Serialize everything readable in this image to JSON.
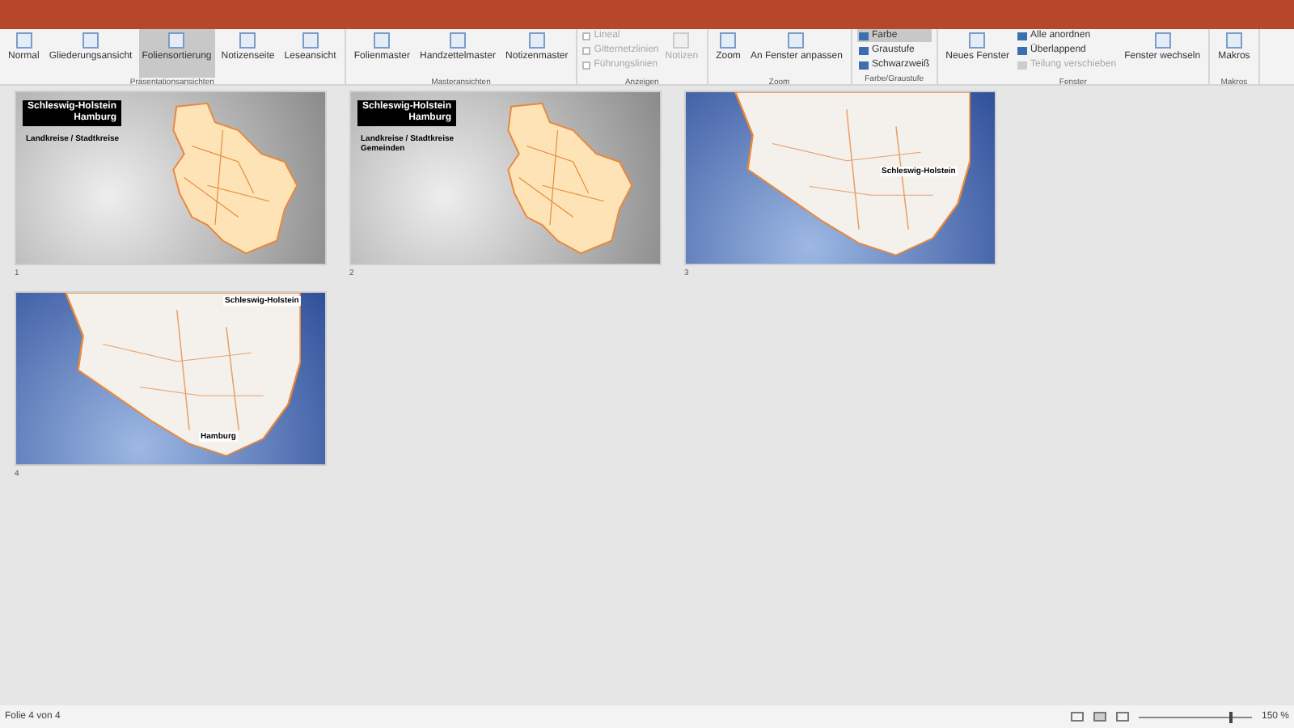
{
  "ribbon": {
    "groups": [
      {
        "label": "Präsentationsansichten",
        "items": [
          {
            "kind": "large",
            "label": "Normal",
            "selected": false,
            "disabled": false
          },
          {
            "kind": "large",
            "label": "Gliederungsansicht",
            "selected": false,
            "disabled": false
          },
          {
            "kind": "large",
            "label": "Foliensortierung",
            "selected": true,
            "disabled": false
          },
          {
            "kind": "large",
            "label": "Notizenseite",
            "selected": false,
            "disabled": false
          },
          {
            "kind": "large",
            "label": "Leseansicht",
            "selected": false,
            "disabled": false
          }
        ]
      },
      {
        "label": "Masteransichten",
        "items": [
          {
            "kind": "large",
            "label": "Folienmaster",
            "selected": false,
            "disabled": false
          },
          {
            "kind": "large",
            "label": "Handzettelmaster",
            "selected": false,
            "disabled": false
          },
          {
            "kind": "large",
            "label": "Notizenmaster",
            "selected": false,
            "disabled": false
          }
        ]
      },
      {
        "label": "Anzeigen",
        "items": [
          {
            "kind": "check",
            "label": "Lineal",
            "checked": false,
            "disabled": true
          },
          {
            "kind": "check",
            "label": "Gitternetzlinien",
            "checked": false,
            "disabled": true
          },
          {
            "kind": "check",
            "label": "Führungslinien",
            "checked": false,
            "disabled": true
          },
          {
            "kind": "large",
            "label": "Notizen",
            "selected": false,
            "disabled": true
          }
        ]
      },
      {
        "label": "Zoom",
        "items": [
          {
            "kind": "large",
            "label": "Zoom",
            "selected": false,
            "disabled": false
          },
          {
            "kind": "large",
            "label": "An Fenster anpassen",
            "selected": false,
            "disabled": false
          }
        ]
      },
      {
        "label": "Farbe/Graustufe",
        "items": [
          {
            "kind": "small",
            "label": "Farbe",
            "selected": true,
            "disabled": false
          },
          {
            "kind": "small",
            "label": "Graustufe",
            "selected": false,
            "disabled": false
          },
          {
            "kind": "small",
            "label": "Schwarzweiß",
            "selected": false,
            "disabled": false
          }
        ]
      },
      {
        "label": "Fenster",
        "items": [
          {
            "kind": "large",
            "label": "Neues Fenster",
            "selected": false,
            "disabled": false
          },
          {
            "kind": "small",
            "label": "Alle anordnen",
            "selected": false,
            "disabled": false
          },
          {
            "kind": "small",
            "label": "Überlappend",
            "selected": false,
            "disabled": false
          },
          {
            "kind": "small",
            "label": "Teilung verschieben",
            "selected": false,
            "disabled": true
          },
          {
            "kind": "large",
            "label": "Fenster wechseln",
            "selected": false,
            "disabled": false
          }
        ]
      },
      {
        "label": "Makros",
        "items": [
          {
            "kind": "large",
            "label": "Makros",
            "selected": false,
            "disabled": false
          }
        ]
      }
    ]
  },
  "slides": [
    {
      "number": "1",
      "kind": "gray",
      "title": [
        "Schleswig-Holstein",
        "Hamburg"
      ],
      "heading": [
        "Landkreise / Stadtkreise"
      ]
    },
    {
      "number": "2",
      "kind": "gray",
      "title": [
        "Schleswig-Holstein",
        "Hamburg"
      ],
      "heading": [
        "Landkreise / Stadtkreise",
        "Gemeinden"
      ]
    },
    {
      "number": "3",
      "kind": "blue",
      "map_labels": [
        "Schleswig-Holstein"
      ]
    },
    {
      "number": "4",
      "kind": "blue",
      "map_labels": [
        "Schleswig-Holstein",
        "Hamburg"
      ]
    }
  ],
  "status_bar": {
    "slide_info": "Folie 4 von 4",
    "zoom": {
      "level": 0.8,
      "reading": "150 %"
    }
  }
}
